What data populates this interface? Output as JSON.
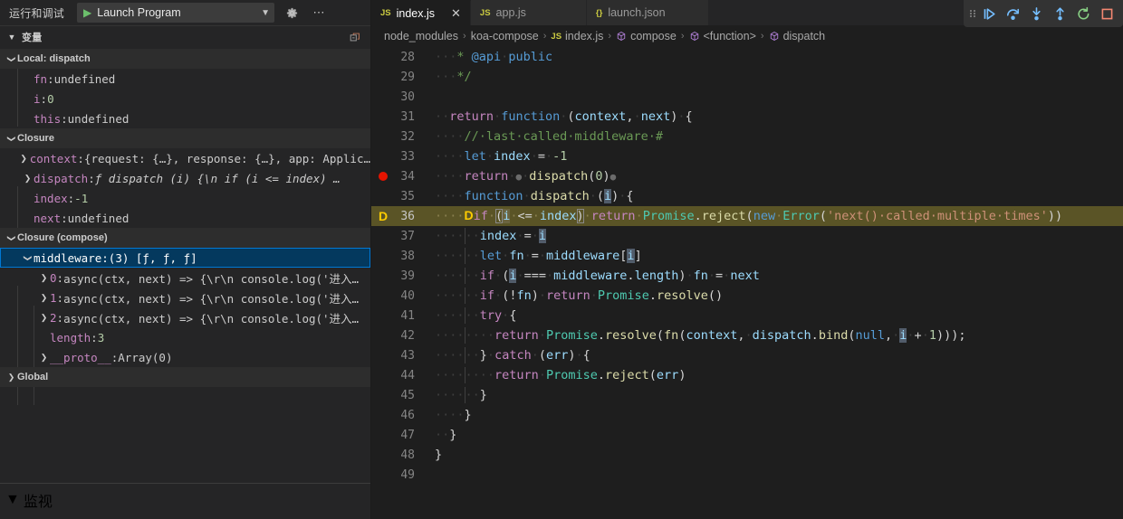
{
  "sidebar": {
    "run_debug_label": "运行和调试",
    "launch_config": {
      "value": "Launch Program",
      "play_icon": "play-icon",
      "chevron": "chevron-down-icon"
    },
    "toolbar_icons": [
      {
        "name": "gear-icon",
        "glyph": "⚙"
      },
      {
        "name": "more-actions-icon",
        "glyph": "···"
      }
    ],
    "variables_panel": {
      "title": "变量",
      "twisty": "⌄",
      "action_icon": "open-in-editor-icon"
    },
    "watch_panel": {
      "title": "监视",
      "twisty": "⌄"
    },
    "rows": [
      {
        "kind": "scope",
        "indent": 0,
        "twisty": "down",
        "label": "Local: dispatch"
      },
      {
        "kind": "var",
        "indent": 1,
        "twisty": "none",
        "name": "fn",
        "sep": ": ",
        "value": "undefined",
        "vclass": "dim"
      },
      {
        "kind": "var",
        "indent": 1,
        "twisty": "none",
        "name": "i",
        "sep": ": ",
        "value": "0",
        "vclass": "num"
      },
      {
        "kind": "var",
        "indent": 1,
        "twisty": "none",
        "name": "this",
        "sep": ": ",
        "value": "undefined",
        "vclass": "dim"
      },
      {
        "kind": "scope",
        "indent": 0,
        "twisty": "down",
        "label": "Closure"
      },
      {
        "kind": "var",
        "indent": 1,
        "twisty": "right",
        "name": "context",
        "sep": ": ",
        "value": "{request: {…}, response: {…}, app: Applic…",
        "vclass": "dim"
      },
      {
        "kind": "var",
        "indent": 1,
        "twisty": "right",
        "name": "dispatch",
        "sep": ": ",
        "value": "ƒ dispatch (i) {\\n        if (i <= index) …",
        "vclass": "fn"
      },
      {
        "kind": "var",
        "indent": 1,
        "twisty": "none",
        "name": "index",
        "sep": ": ",
        "value": "-1",
        "vclass": "num"
      },
      {
        "kind": "var",
        "indent": 1,
        "twisty": "none",
        "name": "next",
        "sep": ": ",
        "value": "undefined",
        "vclass": "dim"
      },
      {
        "kind": "scope",
        "indent": 0,
        "twisty": "down",
        "label": "Closure (compose)"
      },
      {
        "kind": "var",
        "indent": 1,
        "twisty": "down",
        "name": "middleware",
        "sep": ": ",
        "value": "(3) [ƒ, ƒ, ƒ]",
        "vclass": "dim",
        "selected": true
      },
      {
        "kind": "var",
        "indent": 2,
        "twisty": "right",
        "name": "0",
        "sep": ": ",
        "value": "async(ctx, next) => {\\r\\n    console.log('进入…",
        "vclass": "dim"
      },
      {
        "kind": "var",
        "indent": 2,
        "twisty": "right",
        "name": "1",
        "sep": ": ",
        "value": "async(ctx, next) => {\\r\\n    console.log('进入…",
        "vclass": "dim"
      },
      {
        "kind": "var",
        "indent": 2,
        "twisty": "right",
        "name": "2",
        "sep": ": ",
        "value": "async(ctx, next) => {\\r\\n    console.log('进入…",
        "vclass": "dim"
      },
      {
        "kind": "var",
        "indent": 2,
        "twisty": "none",
        "name": "length",
        "sep": ": ",
        "value": "3",
        "vclass": "num"
      },
      {
        "kind": "var",
        "indent": 2,
        "twisty": "right",
        "name": "__proto__",
        "sep": ": ",
        "value": "Array(0)",
        "vclass": "dim"
      },
      {
        "kind": "scope",
        "indent": 0,
        "twisty": "right",
        "label": "Global"
      }
    ]
  },
  "editor": {
    "tabs": [
      {
        "label": "index.js",
        "icon": "js-file-icon",
        "icon_text": "JS",
        "active": true,
        "closable": true,
        "close_glyph": "✕"
      },
      {
        "label": "app.js",
        "icon": "js-file-icon",
        "icon_text": "JS",
        "active": false,
        "closable": false
      },
      {
        "label": "launch.json",
        "icon": "json-file-icon",
        "icon_text": "{}",
        "active": false,
        "closable": false
      }
    ],
    "breadcrumb": [
      {
        "label": "node_modules",
        "icon": null
      },
      {
        "label": "koa-compose",
        "icon": null
      },
      {
        "label": "index.js",
        "icon": "js-file-icon",
        "icon_text": "JS"
      },
      {
        "label": "compose",
        "icon": "symbol-method-icon"
      },
      {
        "label": "<function>",
        "icon": "symbol-method-icon"
      },
      {
        "label": "dispatch",
        "icon": "symbol-method-icon"
      }
    ],
    "breadcrumb_separator": "›",
    "first_line_number": 28,
    "lines": [
      {
        "n": 28,
        "indent": 3,
        "html": "<span class=\"ws\">···</span><span class=\"t-cmt\">* </span><span class=\"t-doc\">@api</span><span class=\"ws\">·</span><span class=\"t-doc\">public</span>"
      },
      {
        "n": 29,
        "indent": 3,
        "html": "<span class=\"ws\">···</span><span class=\"t-cmt\">*/</span>"
      },
      {
        "n": 30,
        "indent": 0,
        "html": ""
      },
      {
        "n": 31,
        "indent": 2,
        "html": "<span class=\"ws\">··</span><span class=\"t-kw\">return</span><span class=\"ws\">·</span><span class=\"t-ctl\">function</span><span class=\"ws\">·</span><span class=\"t-pun\">(</span><span class=\"t-var\">context</span><span class=\"t-pun\">,</span><span class=\"ws\">·</span><span class=\"t-var\">next</span><span class=\"t-pun\">)</span><span class=\"ws\">·</span><span class=\"t-pun\">{</span>"
      },
      {
        "n": 32,
        "indent": 4,
        "html": "<span class=\"ws\">····</span><span class=\"t-cmt\">//·last·called·middleware·#</span>"
      },
      {
        "n": 33,
        "indent": 4,
        "html": "<span class=\"ws\">····</span><span class=\"t-ctl\">let</span><span class=\"ws\">·</span><span class=\"t-var\">index</span><span class=\"ws\">·</span><span class=\"t-pun\">=</span><span class=\"ws\">·</span><span class=\"t-num\">-1</span>"
      },
      {
        "n": 34,
        "indent": 4,
        "breakpoint": true,
        "html": "<span class=\"ws\">····</span><span class=\"t-kw\">return</span><span class=\"ws\">·</span><span class=\"inline-bp\">●</span><span class=\"ws\">·</span><span class=\"t-fn\">dispatch</span><span class=\"t-pun\">(</span><span class=\"t-num\">0</span><span class=\"t-pun\">)</span><span class=\"inline-bp\">●</span>"
      },
      {
        "n": 35,
        "indent": 4,
        "html": "<span class=\"ws\">····</span><span class=\"t-ctl\">function</span><span class=\"ws\">·</span><span class=\"t-fn\">dispatch</span><span class=\"ws\">·</span><span class=\"t-pun\">(</span><span class=\"t-var hl-occ\">i</span><span class=\"t-pun\">)</span><span class=\"ws\">·</span><span class=\"t-pun\">{</span>"
      },
      {
        "n": 36,
        "indent": 4,
        "current": true,
        "html": "<span class=\"ws-cur\">····</span><span class=\"stack-arrow\">D</span><span class=\"t-kw\">if</span><span class=\"ws-cur\">·</span><span class=\"t-pun brk-match\">(</span><span class=\"t-var hl-occ\">i</span><span class=\"ws-cur\">·</span><span class=\"t-pun\">&lt;=</span><span class=\"ws-cur\">·</span><span class=\"t-var\">index</span><span class=\"t-pun brk-match\">)</span><span class=\"ws-cur\">·</span><span class=\"t-kw\">return</span><span class=\"ws-cur\">·</span><span class=\"t-type\">Promise</span><span class=\"t-pun\">.</span><span class=\"t-fn\">reject</span><span class=\"t-pun\">(</span><span class=\"t-ctl\">new</span><span class=\"ws-cur\">·</span><span class=\"t-type\">Error</span><span class=\"t-pun\">(</span><span class=\"t-str\">'next()·called·multiple·times'</span><span class=\"t-pun\">))</span>"
      },
      {
        "n": 37,
        "indent": 6,
        "html": "<span class=\"ws\">····</span><span class=\"indent-guide\"></span><span class=\"ws\">··</span><span class=\"t-var\">index</span><span class=\"ws\">·</span><span class=\"t-pun\">=</span><span class=\"ws\">·</span><span class=\"t-var hl-occ\">i</span>"
      },
      {
        "n": 38,
        "indent": 6,
        "html": "<span class=\"ws\">····</span><span class=\"indent-guide\"></span><span class=\"ws\">··</span><span class=\"t-ctl\">let</span><span class=\"ws\">·</span><span class=\"t-var\">fn</span><span class=\"ws\">·</span><span class=\"t-pun\">=</span><span class=\"ws\">·</span><span class=\"t-var\">middleware</span><span class=\"t-pun\">[</span><span class=\"t-var hl-occ\">i</span><span class=\"t-pun\">]</span>"
      },
      {
        "n": 39,
        "indent": 6,
        "html": "<span class=\"ws\">····</span><span class=\"indent-guide\"></span><span class=\"ws\">··</span><span class=\"t-kw\">if</span><span class=\"ws\">·</span><span class=\"t-pun\">(</span><span class=\"t-var hl-occ\">i</span><span class=\"ws\">·</span><span class=\"t-pun\">===</span><span class=\"ws\">·</span><span class=\"t-var\">middleware</span><span class=\"t-pun\">.</span><span class=\"t-var\">length</span><span class=\"t-pun\">)</span><span class=\"ws\">·</span><span class=\"t-var\">fn</span><span class=\"ws\">·</span><span class=\"t-pun\">=</span><span class=\"ws\">·</span><span class=\"t-var\">next</span>"
      },
      {
        "n": 40,
        "indent": 6,
        "html": "<span class=\"ws\">····</span><span class=\"indent-guide\"></span><span class=\"ws\">··</span><span class=\"t-kw\">if</span><span class=\"ws\">·</span><span class=\"t-pun\">(!</span><span class=\"t-var\">fn</span><span class=\"t-pun\">)</span><span class=\"ws\">·</span><span class=\"t-kw\">return</span><span class=\"ws\">·</span><span class=\"t-type\">Promise</span><span class=\"t-pun\">.</span><span class=\"t-fn\">resolve</span><span class=\"t-pun\">()</span>"
      },
      {
        "n": 41,
        "indent": 6,
        "html": "<span class=\"ws\">····</span><span class=\"indent-guide\"></span><span class=\"ws\">··</span><span class=\"t-kw\">try</span><span class=\"ws\">·</span><span class=\"t-pun\">{</span>"
      },
      {
        "n": 42,
        "indent": 8,
        "html": "<span class=\"ws\">····</span><span class=\"indent-guide\"></span><span class=\"ws\">····</span><span class=\"t-kw\">return</span><span class=\"ws\">·</span><span class=\"t-type\">Promise</span><span class=\"t-pun\">.</span><span class=\"t-fn\">resolve</span><span class=\"t-pun\">(</span><span class=\"t-fn\">fn</span><span class=\"t-pun\">(</span><span class=\"t-var\">context</span><span class=\"t-pun\">,</span><span class=\"ws\">·</span><span class=\"t-var\">dispatch</span><span class=\"t-pun\">.</span><span class=\"t-fn\">bind</span><span class=\"t-pun\">(</span><span class=\"t-ctl\">null</span><span class=\"t-pun\">,</span><span class=\"ws\">·</span><span class=\"t-var hl-occ\">i</span><span class=\"ws\">·</span><span class=\"t-pun\">+</span><span class=\"ws\">·</span><span class=\"t-num\">1</span><span class=\"t-pun\">)));</span>"
      },
      {
        "n": 43,
        "indent": 6,
        "html": "<span class=\"ws\">····</span><span class=\"indent-guide\"></span><span class=\"ws\">··</span><span class=\"t-pun\">}</span><span class=\"ws\">·</span><span class=\"t-kw\">catch</span><span class=\"ws\">·</span><span class=\"t-pun\">(</span><span class=\"t-var\">err</span><span class=\"t-pun\">)</span><span class=\"ws\">·</span><span class=\"t-pun\">{</span>"
      },
      {
        "n": 44,
        "indent": 8,
        "html": "<span class=\"ws\">····</span><span class=\"indent-guide\"></span><span class=\"ws\">····</span><span class=\"t-kw\">return</span><span class=\"ws\">·</span><span class=\"t-type\">Promise</span><span class=\"t-pun\">.</span><span class=\"t-fn\">reject</span><span class=\"t-pun\">(</span><span class=\"t-var\">err</span><span class=\"t-pun\">)</span>"
      },
      {
        "n": 45,
        "indent": 6,
        "html": "<span class=\"ws\">····</span><span class=\"indent-guide\"></span><span class=\"ws\">··</span><span class=\"t-pun\">}</span>"
      },
      {
        "n": 46,
        "indent": 4,
        "html": "<span class=\"ws\">····</span><span class=\"t-pun\">}</span>"
      },
      {
        "n": 47,
        "indent": 2,
        "html": "<span class=\"ws\">··</span><span class=\"t-pun\">}</span>"
      },
      {
        "n": 48,
        "indent": 0,
        "html": "<span class=\"t-pun\">}</span>"
      },
      {
        "n": 49,
        "indent": 0,
        "html": ""
      }
    ]
  },
  "debug_toolbar": {
    "grip": "drag-handle-icon",
    "buttons": [
      {
        "name": "continue-button",
        "label": "Continue",
        "color": "#75beff"
      },
      {
        "name": "step-over-button",
        "label": "Step Over",
        "color": "#75beff"
      },
      {
        "name": "step-into-button",
        "label": "Step Into",
        "color": "#75beff"
      },
      {
        "name": "step-out-button",
        "label": "Step Out",
        "color": "#75beff"
      },
      {
        "name": "restart-button",
        "label": "Restart",
        "color": "#89d185"
      },
      {
        "name": "stop-button",
        "label": "Stop",
        "color": "#f48771"
      }
    ]
  },
  "colors": {
    "editor_bg": "#1e1e1e",
    "sidebar_bg": "#252526",
    "current_line": "#5a5426",
    "breakpoint": "#e51400",
    "selection": "#04395e",
    "accent": "#0078d4"
  }
}
